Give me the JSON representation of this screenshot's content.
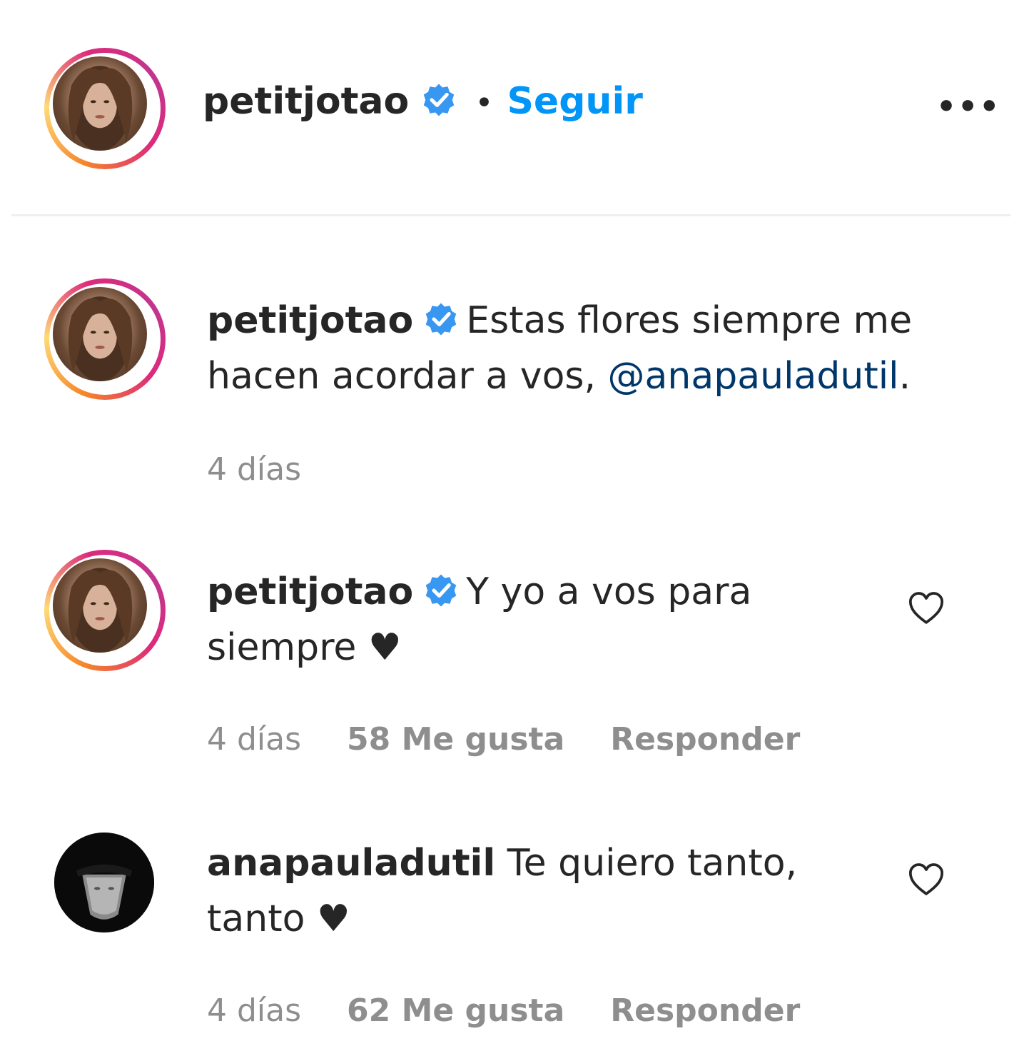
{
  "header": {
    "username": "petitjotao",
    "separator": "•",
    "follow_label": "Seguir",
    "more_label": "•••"
  },
  "caption": {
    "username": "petitjotao",
    "text": "Estas flores siempre me hacen acordar a vos, ",
    "mention": "@anapauladutil",
    "trailing": ".",
    "time": "4 días"
  },
  "comments": [
    {
      "username": "petitjotao",
      "text": "Y yo a vos para siempre ♥",
      "time": "4 días",
      "likes": "58 Me gusta",
      "reply": "Responder"
    },
    {
      "username": "anapauladutil",
      "text": "Te quiero tanto, tanto ♥",
      "time": "4 días",
      "likes": "62 Me gusta",
      "reply": "Responder"
    }
  ],
  "colors": {
    "link": "#0095f6",
    "mention": "#00376b",
    "muted": "#8e8e8e",
    "text": "#262626",
    "verified": "#3897f0"
  },
  "icons": [
    "verified-badge-icon",
    "more-options-icon",
    "heart-icon"
  ]
}
